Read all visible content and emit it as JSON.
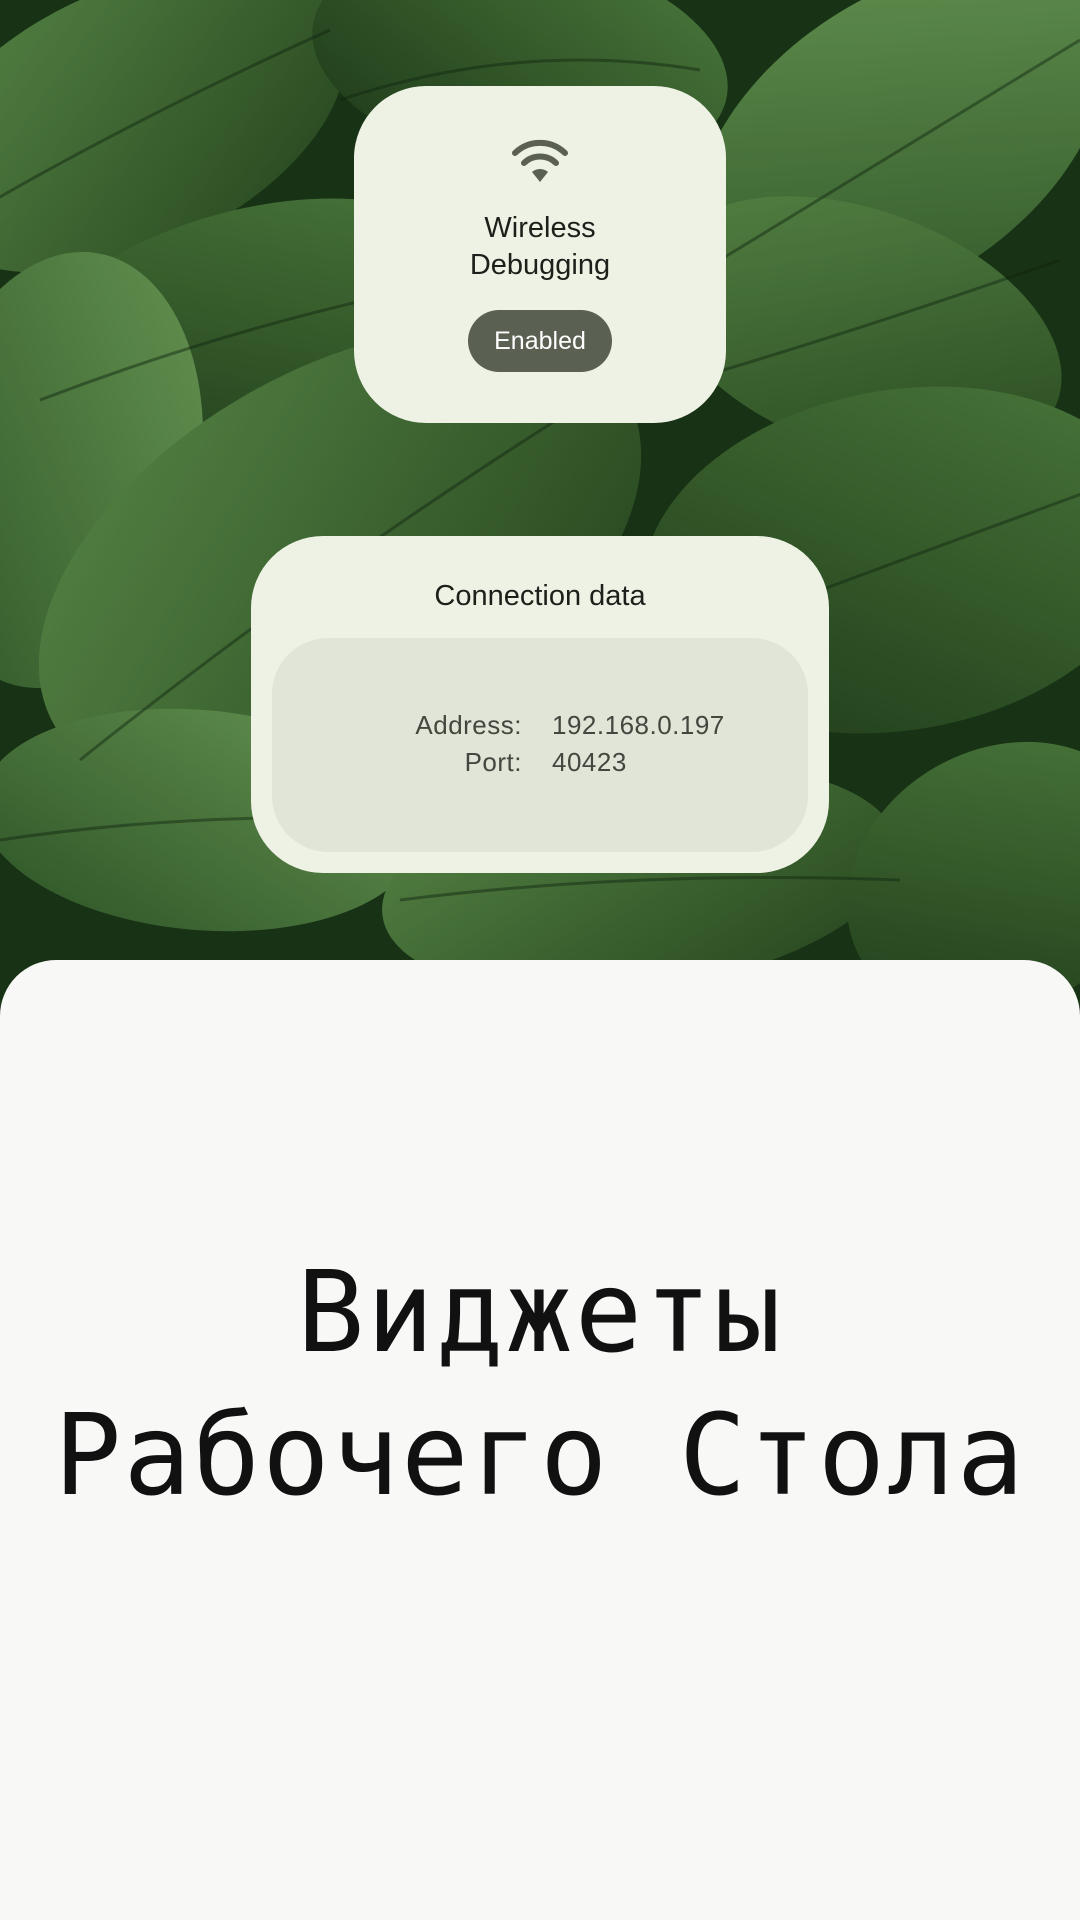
{
  "widgets": {
    "wireless_debugging": {
      "icon": "wifi-icon",
      "title": "Wireless Debugging",
      "status": "Enabled"
    },
    "connection_data": {
      "title": "Connection data",
      "address_label": "Address:",
      "address_value": "192.168.0.197",
      "port_label": "Port:",
      "port_value": "40423"
    }
  },
  "sheet": {
    "title": "Виджеты Рабочего Стола"
  },
  "colors": {
    "widget_bg": "#eef2e4",
    "widget_inner_bg": "#e0e5d7",
    "chip_bg": "#5b6152",
    "icon_color": "#5b6152",
    "sheet_bg": "#f8f8f6"
  }
}
